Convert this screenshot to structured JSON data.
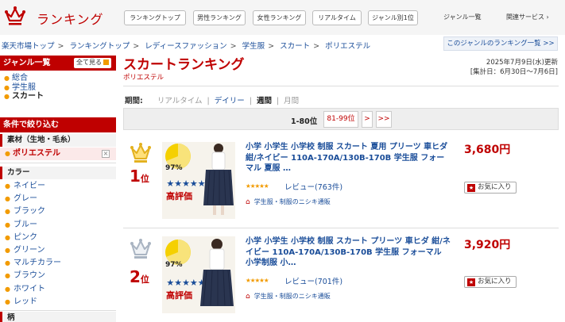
{
  "header": {
    "logo_text": "ランキング",
    "buttons": [
      "ランキングトップ",
      "男性ランキング",
      "女性ランキング",
      "リアルタイム",
      "ジャンル別1位"
    ],
    "genre_list": "ジャンル一覧",
    "related": "関連サービス ›"
  },
  "breadcrumb": [
    "楽天市場トップ",
    "ランキングトップ",
    "レディースファッション",
    "学生服",
    "スカート",
    "ポリエステル"
  ],
  "breadcrumb_sep": ">",
  "genre_ranking_link": "このジャンルのランキング一覧 >>",
  "sidebar": {
    "genre_title": "ジャンル一覧",
    "show_all": "全て見る",
    "genres": [
      "総合",
      "学生服",
      "スカート"
    ],
    "filter_title": "条件で絞り込む",
    "material_title": "素材（生地・毛糸）",
    "material_selected": "ポリエステル",
    "color_title": "カラー",
    "colors": [
      "ネイビー",
      "グレー",
      "ブラック",
      "ブルー",
      "ピンク",
      "グリーン",
      "マルチカラー",
      "ブラウン",
      "ホワイト",
      "レッド"
    ],
    "pattern_title": "柄"
  },
  "main": {
    "title": "スカートランキング",
    "subtitle": "ポリエステル",
    "date_line1": "2025年7月9日(水)更新",
    "date_line2": "[集計日：6月30日～7月6日]",
    "period_label": "期間:",
    "period_realtime": "リアルタイム",
    "period_daily": "デイリー",
    "period_weekly": "週間",
    "period_monthly": "月間",
    "pager_current": "1-80位",
    "pager_next": "81-99位",
    "pager_gt": ">",
    "pager_last": ">>"
  },
  "items": [
    {
      "rank": "1",
      "rank_suffix": "位",
      "title": "小学 小学生 小学校 制服 スカート 夏用 プリーツ 車ヒダ 紺/ネイビー 110A-170A/130B-170B 学生服 フォーマル 夏服 …",
      "stars": "★★★★★",
      "review": "レビュー(763件)",
      "shop": "学生服・制服のニシキ通販",
      "price": "3,680円",
      "fav": "お気に入り",
      "badge_pct": "97%",
      "badge_text": "高評価"
    },
    {
      "rank": "2",
      "rank_suffix": "位",
      "title": "小学 小学生 小学校 制服 スカート プリーツ 車ヒダ 紺/ネイビー 110A-170A/130B-170B 学生服 フォーマル 小学制服 小…",
      "stars": "★★★★★",
      "review": "レビュー(701件)",
      "shop": "学生服・制服のニシキ通販",
      "price": "3,920円",
      "fav": "お気に入り",
      "badge_pct": "97%",
      "badge_text": "高評価"
    }
  ],
  "colors": {
    "brand": "#bf0000",
    "link": "#1a4d99",
    "accent": "#f29b00"
  }
}
